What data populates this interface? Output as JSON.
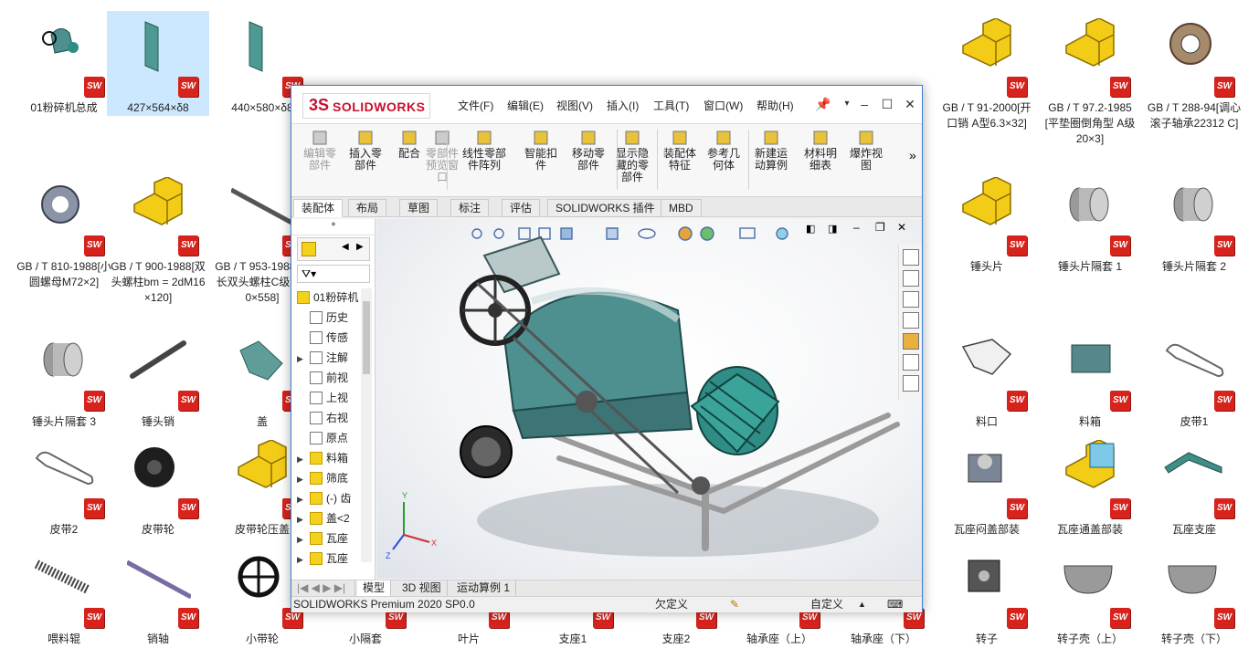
{
  "desktop": {
    "files": [
      {
        "label": "01粉碎机总成",
        "icon": "assembly-thumbnail",
        "sel": false
      },
      {
        "label": "427×564×δ8",
        "icon": "plate-thumbnail",
        "sel": true
      },
      {
        "label": "440×580×δ8",
        "icon": "plate-thumbnail",
        "sel": false
      },
      {
        "label": "GB / T 91-2000[开口销 A型6.3×32]",
        "icon": "standard-part-icon",
        "sel": false
      },
      {
        "label": "GB / T 97.2-1985[平垫圈倒角型 A级20×3]",
        "icon": "standard-part-icon",
        "sel": false
      },
      {
        "label": "GB / T 288-94[调心滚子轴承22312 C]",
        "icon": "bearing-thumbnail",
        "sel": false
      },
      {
        "label": "GB / T 810-1988[小圆螺母M72×2]",
        "icon": "nut-thumbnail",
        "sel": false
      },
      {
        "label": "GB / T 900-1988[双头螺柱bm = 2dM16×120]",
        "icon": "standard-part-icon",
        "sel": false
      },
      {
        "label": "GB / T 953-1988[等长双头螺柱C级 M20×558]",
        "icon": "stud-thumbnail",
        "sel": false
      },
      {
        "label": "锤头片",
        "icon": "standard-part-icon",
        "sel": false
      },
      {
        "label": "锤头片隔套 1",
        "icon": "sleeve-thumbnail",
        "sel": false
      },
      {
        "label": "锤头片隔套 2",
        "icon": "sleeve-thumbnail",
        "sel": false
      },
      {
        "label": "锤头片隔套 3",
        "icon": "sleeve-thumbnail",
        "sel": false
      },
      {
        "label": "锤头销",
        "icon": "pin-thumbnail",
        "sel": false
      },
      {
        "label": "盖",
        "icon": "cover-thumbnail",
        "sel": false
      },
      {
        "label": "料口",
        "icon": "hopper-thumbnail",
        "sel": false
      },
      {
        "label": "料箱",
        "icon": "box-thumbnail",
        "sel": false
      },
      {
        "label": "皮带1",
        "icon": "belt-thumbnail",
        "sel": false
      },
      {
        "label": "皮带2",
        "icon": "belt-thumbnail",
        "sel": false
      },
      {
        "label": "皮带轮",
        "icon": "pulley-thumbnail",
        "sel": false
      },
      {
        "label": "皮带轮压盖",
        "icon": "standard-part-icon",
        "sel": false
      },
      {
        "label": "瓦座闷盖部装",
        "icon": "bearing-block-thumbnail",
        "sel": false
      },
      {
        "label": "瓦座通盖部装",
        "icon": "assembly-part-icon",
        "sel": false
      },
      {
        "label": "瓦座支座",
        "icon": "bracket-thumbnail",
        "sel": false
      },
      {
        "label": "喂料辊",
        "icon": "roller-thumbnail",
        "sel": false
      },
      {
        "label": "销轴",
        "icon": "shaft-thumbnail",
        "sel": false
      },
      {
        "label": "小带轮",
        "icon": "wheel-thumbnail",
        "sel": false
      },
      {
        "label": "小隔套",
        "icon": "sleeve-thumbnail",
        "sel": false
      },
      {
        "label": "叶片",
        "icon": "blade-thumbnail",
        "sel": false
      },
      {
        "label": "支座1",
        "icon": "support-thumbnail",
        "sel": false
      },
      {
        "label": "支座2",
        "icon": "support-thumbnail",
        "sel": false
      },
      {
        "label": "轴承座（上）",
        "icon": "bearing-seat-thumbnail",
        "sel": false
      },
      {
        "label": "轴承座（下）",
        "icon": "bearing-seat-thumbnail",
        "sel": false
      },
      {
        "label": "转子",
        "icon": "rotor-thumbnail",
        "sel": false
      },
      {
        "label": "转子壳（上）",
        "icon": "shell-thumbnail",
        "sel": false
      },
      {
        "label": "转子壳（下）",
        "icon": "shell-thumbnail",
        "sel": false
      }
    ],
    "sw_badge": "SW"
  },
  "window": {
    "logo_ds": "3S",
    "logo_text": "SOLIDWORKS",
    "menus": [
      "文件(F)",
      "编辑(E)",
      "视图(V)",
      "插入(I)",
      "工具(T)",
      "窗口(W)",
      "帮助(H)"
    ],
    "ribbon": [
      {
        "label": "编辑零\n部件",
        "disabled": true
      },
      {
        "label": "插入零\n部件",
        "disabled": false
      },
      {
        "label": "配合",
        "disabled": false
      },
      {
        "label": "零部件\n预览窗\n口",
        "disabled": true
      },
      {
        "label": "线性零部\n件阵列",
        "disabled": false
      },
      {
        "label": "智能扣\n件",
        "disabled": false
      },
      {
        "label": "移动零\n部件",
        "disabled": false
      },
      {
        "label": "显示隐\n藏的零\n部件",
        "disabled": false
      },
      {
        "label": "装配体\n特征",
        "disabled": false
      },
      {
        "label": "参考几\n何体",
        "disabled": false
      },
      {
        "label": "新建运\n动算例",
        "disabled": false
      },
      {
        "label": "材料明\n细表",
        "disabled": false
      },
      {
        "label": "爆炸视\n图",
        "disabled": false
      }
    ],
    "tabs": [
      "装配体",
      "布局",
      "草图",
      "标注",
      "评估",
      "SOLIDWORKS 插件",
      "MBD"
    ],
    "tree": {
      "root": "01粉碎机",
      "items": [
        "历史",
        "传感",
        "注解",
        "前视",
        "上视",
        "右视",
        "原点",
        "料箱",
        "筛底",
        "(-) 齿",
        "盖<2",
        "瓦座",
        "瓦座"
      ]
    },
    "bottom_tabs": [
      "模型",
      "3D 视图",
      "运动算例 1"
    ],
    "status": {
      "product": "SOLIDWORKS Premium 2020 SP0.0",
      "state": "欠定义",
      "custom": "自定义"
    },
    "axes": {
      "x": "X",
      "y": "Y",
      "z": "Z"
    }
  }
}
